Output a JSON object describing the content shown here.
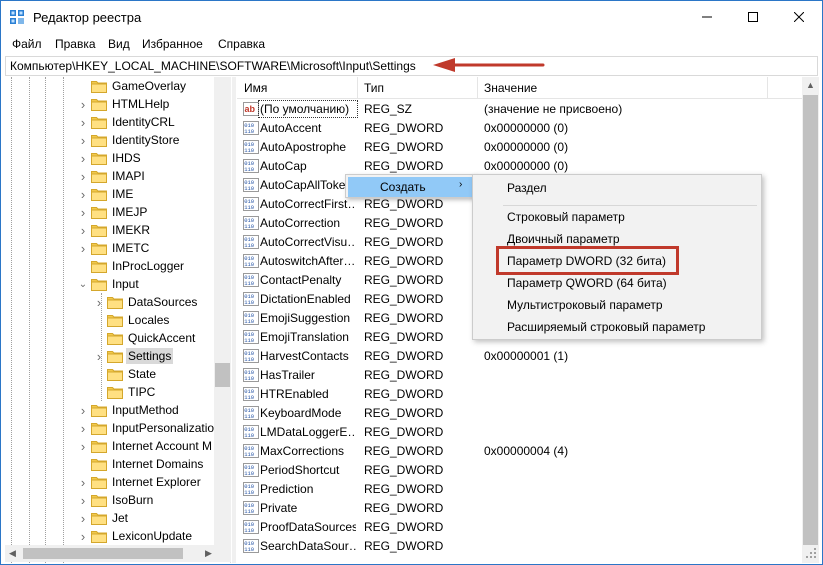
{
  "window": {
    "title": "Редактор реестра"
  },
  "menu": [
    "Файл",
    "Правка",
    "Вид",
    "Избранное",
    "Справка"
  ],
  "address": {
    "path": "Компьютер\\HKEY_LOCAL_MACHINE\\SOFTWARE\\Microsoft\\Input\\Settings"
  },
  "tree": [
    {
      "label": "GameOverlay",
      "indent": 0,
      "chev": false
    },
    {
      "label": "HTMLHelp",
      "indent": 0,
      "chev": true
    },
    {
      "label": "IdentityCRL",
      "indent": 0,
      "chev": true
    },
    {
      "label": "IdentityStore",
      "indent": 0,
      "chev": true
    },
    {
      "label": "IHDS",
      "indent": 0,
      "chev": true
    },
    {
      "label": "IMAPI",
      "indent": 0,
      "chev": true
    },
    {
      "label": "IME",
      "indent": 0,
      "chev": true
    },
    {
      "label": "IMEJP",
      "indent": 0,
      "chev": true
    },
    {
      "label": "IMEKR",
      "indent": 0,
      "chev": true
    },
    {
      "label": "IMETC",
      "indent": 0,
      "chev": true
    },
    {
      "label": "InProcLogger",
      "indent": 0,
      "chev": false
    },
    {
      "label": "Input",
      "indent": 0,
      "chev": "open"
    },
    {
      "label": "DataSources",
      "indent": 1,
      "chev": true
    },
    {
      "label": "Locales",
      "indent": 1,
      "chev": false
    },
    {
      "label": "QuickAccent",
      "indent": 1,
      "chev": false
    },
    {
      "label": "Settings",
      "indent": 1,
      "chev": true,
      "selected": true
    },
    {
      "label": "State",
      "indent": 1,
      "chev": false
    },
    {
      "label": "TIPC",
      "indent": 1,
      "chev": false
    },
    {
      "label": "InputMethod",
      "indent": 0,
      "chev": true
    },
    {
      "label": "InputPersonalizatio",
      "indent": 0,
      "chev": true
    },
    {
      "label": "Internet Account M",
      "indent": 0,
      "chev": true
    },
    {
      "label": "Internet Domains",
      "indent": 0,
      "chev": false
    },
    {
      "label": "Internet Explorer",
      "indent": 0,
      "chev": true
    },
    {
      "label": "IsoBurn",
      "indent": 0,
      "chev": true
    },
    {
      "label": "Jet",
      "indent": 0,
      "chev": true
    },
    {
      "label": "LexiconUpdate",
      "indent": 0,
      "chev": true
    }
  ],
  "columns": {
    "name": "Имя",
    "type": "Тип",
    "value": "Значение"
  },
  "rows": [
    {
      "name": "(По умолчанию)",
      "type": "REG_SZ",
      "value": "(значение не присвоено)",
      "icon": "string-value-icon"
    },
    {
      "name": "AutoAccent",
      "type": "REG_DWORD",
      "value": "0x00000000 (0)",
      "icon": "dword-value-icon"
    },
    {
      "name": "AutoApostrophe",
      "type": "REG_DWORD",
      "value": "0x00000000 (0)",
      "icon": "dword-value-icon"
    },
    {
      "name": "AutoCap",
      "type": "REG_DWORD",
      "value": "0x00000000 (0)",
      "icon": "dword-value-icon"
    },
    {
      "name": "AutoCapAllToke",
      "type": "",
      "value": "",
      "icon": "dword-value-icon"
    },
    {
      "name": "AutoCorrectFirst…",
      "type": "REG_DWORD",
      "value": "",
      "icon": "dword-value-icon"
    },
    {
      "name": "AutoCorrection",
      "type": "REG_DWORD",
      "value": "",
      "icon": "dword-value-icon"
    },
    {
      "name": "AutoCorrectVisu…",
      "type": "REG_DWORD",
      "value": "",
      "icon": "dword-value-icon"
    },
    {
      "name": "AutoswitchAfter…",
      "type": "REG_DWORD",
      "value": "",
      "icon": "dword-value-icon"
    },
    {
      "name": "ContactPenalty",
      "type": "REG_DWORD",
      "value": "",
      "icon": "dword-value-icon"
    },
    {
      "name": "DictationEnabled",
      "type": "REG_DWORD",
      "value": "",
      "icon": "dword-value-icon"
    },
    {
      "name": "EmojiSuggestion",
      "type": "REG_DWORD",
      "value": "",
      "icon": "dword-value-icon"
    },
    {
      "name": "EmojiTranslation",
      "type": "REG_DWORD",
      "value": "",
      "icon": "dword-value-icon"
    },
    {
      "name": "HarvestContacts",
      "type": "REG_DWORD",
      "value": "0x00000001 (1)",
      "icon": "dword-value-icon"
    },
    {
      "name": "HasTrailer",
      "type": "REG_DWORD",
      "value": "",
      "icon": "dword-value-icon"
    },
    {
      "name": "HTREnabled",
      "type": "REG_DWORD",
      "value": "",
      "icon": "dword-value-icon"
    },
    {
      "name": "KeyboardMode",
      "type": "REG_DWORD",
      "value": "",
      "icon": "dword-value-icon"
    },
    {
      "name": "LMDataLoggerE…",
      "type": "REG_DWORD",
      "value": "",
      "icon": "dword-value-icon"
    },
    {
      "name": "MaxCorrections",
      "type": "REG_DWORD",
      "value": "0x00000004 (4)",
      "icon": "dword-value-icon"
    },
    {
      "name": "PeriodShortcut",
      "type": "REG_DWORD",
      "value": "",
      "icon": "dword-value-icon"
    },
    {
      "name": "Prediction",
      "type": "REG_DWORD",
      "value": "",
      "icon": "dword-value-icon"
    },
    {
      "name": "Private",
      "type": "REG_DWORD",
      "value": "",
      "icon": "dword-value-icon"
    },
    {
      "name": "ProofDataSources",
      "type": "REG_DWORD",
      "value": "",
      "icon": "dword-value-icon"
    },
    {
      "name": "SearchDataSour…",
      "type": "REG_DWORD",
      "value": "",
      "icon": "dword-value-icon"
    }
  ],
  "context_menu": {
    "create_label": "Создать"
  },
  "submenu": [
    "Раздел",
    "Строковый параметр",
    "Двоичный параметр",
    "Параметр DWORD (32 бита)",
    "Параметр QWORD (64 бита)",
    "Мультистроковый параметр",
    "Расширяемый строковый параметр"
  ],
  "colors": {
    "highlight": "#91c9f7",
    "annotation_red": "#c0392b",
    "folder": "#f2c94c",
    "window_border": "#2b76c7"
  }
}
